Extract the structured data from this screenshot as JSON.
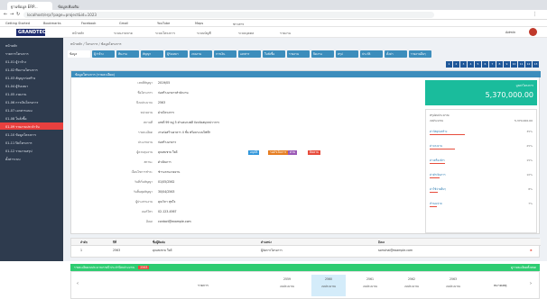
{
  "browser": {
    "tab_active": "ฐานข้อมูล ERP...",
    "tab_other": "ข้อมูลเพิ่มเติม",
    "url": "localhost/erp/?page=project&id=1023",
    "bookmarks": [
      "Getting Started",
      "Bookmarks",
      "Facebook",
      "Gmail",
      "YouTube",
      "Maps",
      "ข่าวสาร"
    ]
  },
  "app": {
    "logo": "GRANDTECH",
    "nav": [
      "หน้าหลัก",
      "ระบบงานขาย",
      "ระบบโครงการ",
      "ระบบบัญชี",
      "ระบบบุคคล",
      "รายงาน"
    ],
    "user": "Admin"
  },
  "sidebar": {
    "items": [
      "หน้าหลัก",
      "รายการโครงการ",
      "01-01 ผู้ว่าจ้าง",
      "01-02 ทีมงานโครงการ",
      "01-03 สัญญาก่อสร้าง",
      "01-04 ผู้รับเหมา",
      "01-05 งวดงาน",
      "01-06 การเงินโครงการ",
      "01-07 เอกสารแนบ",
      "01-08 ใบสั่งซื้อ",
      "01-09 รายงานประจำวัน",
      "01-10 ข้อมูลโครงการ",
      "01-11 ปิดโครงการ",
      "01-12 รายงานสรุป",
      "ตั้งค่าระบบ"
    ],
    "active_index": 10
  },
  "breadcrumb": "หน้าหลัก / โครงการ / ข้อมูลโครงการ",
  "page_tabs": [
    "ข้อมูล",
    "ผู้ว่าจ้าง",
    "ทีมงาน",
    "สัญญา",
    "ผู้รับเหมา",
    "งวดงาน",
    "การเงิน",
    "เอกสาร",
    "ใบสั่งซื้อ",
    "รายงาน",
    "ปิดงาน",
    "สรุป",
    "ประวัติ",
    "ตั้งค่า",
    "รายงานอื่นๆ"
  ],
  "page_numbers": [
    "1",
    "2",
    "3",
    "4",
    "5",
    "6",
    "7",
    "8",
    "9",
    "10",
    "11",
    "12",
    "13"
  ],
  "panel": {
    "title": "ข้อมูลโครงการ (รายละเอียด)",
    "fields": [
      {
        "label": "เลขที่สัญญา",
        "value": "2019/05"
      },
      {
        "label": "ชื่อโครงการ",
        "value": "ก่อสร้างอาคารสำนักงาน"
      },
      {
        "label": "ปีงบประมาณ",
        "value": "2563"
      },
      {
        "label": "หน่วยงาน",
        "value": "ฝ่ายโครงการ"
      },
      {
        "label": "สถานที่",
        "value": "เลขที่ 99 หมู่ 5 ตำบลบางพลี จังหวัดสมุทรปราการ"
      },
      {
        "label": "รายละเอียด",
        "value": "งานก่อสร้างอาคาร 4 ชั้น พร้อมระบบไฟฟ้า"
      },
      {
        "label": "ประเภทงาน",
        "value": "ก่อสร้างอาคาร"
      },
      {
        "label": "ผู้ควบคุมงาน",
        "value": "คุณสมชาย ใจดี"
      },
      {
        "label": "สถานะ",
        "value": "ดำเนินการ"
      },
      {
        "label": "เงื่อนไขการชำระ",
        "value": "ชำระตามงวดงาน"
      },
      {
        "label": "วันที่เริ่มสัญญา",
        "value": "01/05/2562"
      },
      {
        "label": "วันสิ้นสุดสัญญา",
        "value": "30/04/2563"
      },
      {
        "label": "ผู้ประสานงาน",
        "value": "คุณวิภา สุขใจ"
      },
      {
        "label": "เบอร์โทร",
        "value": "02-123-4567"
      },
      {
        "label": "อีเมล",
        "value": "contact@example.com"
      }
    ],
    "badges": [
      "อนุมัติ",
      "รอดำเนินการ",
      "ด่วน",
      "ติดตาม"
    ],
    "badge_colors": [
      "#3498db",
      "#e67e22",
      "#9b59b6",
      "#e74c3c"
    ]
  },
  "total": {
    "label": "มูลค่าโครงการ",
    "value": "5,370,000.00"
  },
  "summary": {
    "title": "สรุปงบประมาณ",
    "budget_label": "งบประมาณ",
    "budget_value": "5,370,000.00",
    "items": [
      {
        "label": "ค่าวัสดุก่อสร้าง",
        "pct": "35%",
        "fill": 0.35
      },
      {
        "label": "ค่าแรงงาน",
        "pct": "25%",
        "fill": 0.25
      },
      {
        "label": "ค่าเครื่องจักร",
        "pct": "15%",
        "fill": 0.15
      },
      {
        "label": "ค่าดำเนินการ",
        "pct": "10%",
        "fill": 0.1
      },
      {
        "label": "ค่าใช้จ่ายอื่นๆ",
        "pct": "8%",
        "fill": 0.08
      },
      {
        "label": "สำรองจ่าย",
        "pct": "7%",
        "fill": 0.07
      }
    ]
  },
  "table": {
    "headers": [
      "ลำดับ",
      "ปีที่",
      "ชื่อผู้ติดต่อ",
      "ตำแหน่ง",
      "อีเมล"
    ],
    "row": [
      "1",
      "2563",
      "คุณสมชาย ใจดี",
      "ผู้จัดการโครงการ",
      "somchai@example.com"
    ]
  },
  "green_bar": {
    "text": "รายละเอียดงบประมาณรายปี ประจำปีงบประมาณ",
    "badge": "2563",
    "right": "ดูรายละเอียดทั้งหมด"
  },
  "years": {
    "label": "รายการ",
    "cols": [
      {
        "year": "2559",
        "sub": "งบประมาณ"
      },
      {
        "year": "2560",
        "sub": "งบประมาณ"
      },
      {
        "year": "2561",
        "sub": "งบประมาณ"
      },
      {
        "year": "2562",
        "sub": "งบประมาณ"
      },
      {
        "year": "2563",
        "sub": "งบประมาณ"
      }
    ],
    "highlight_index": 1,
    "last_col": "หมายเหตุ"
  }
}
